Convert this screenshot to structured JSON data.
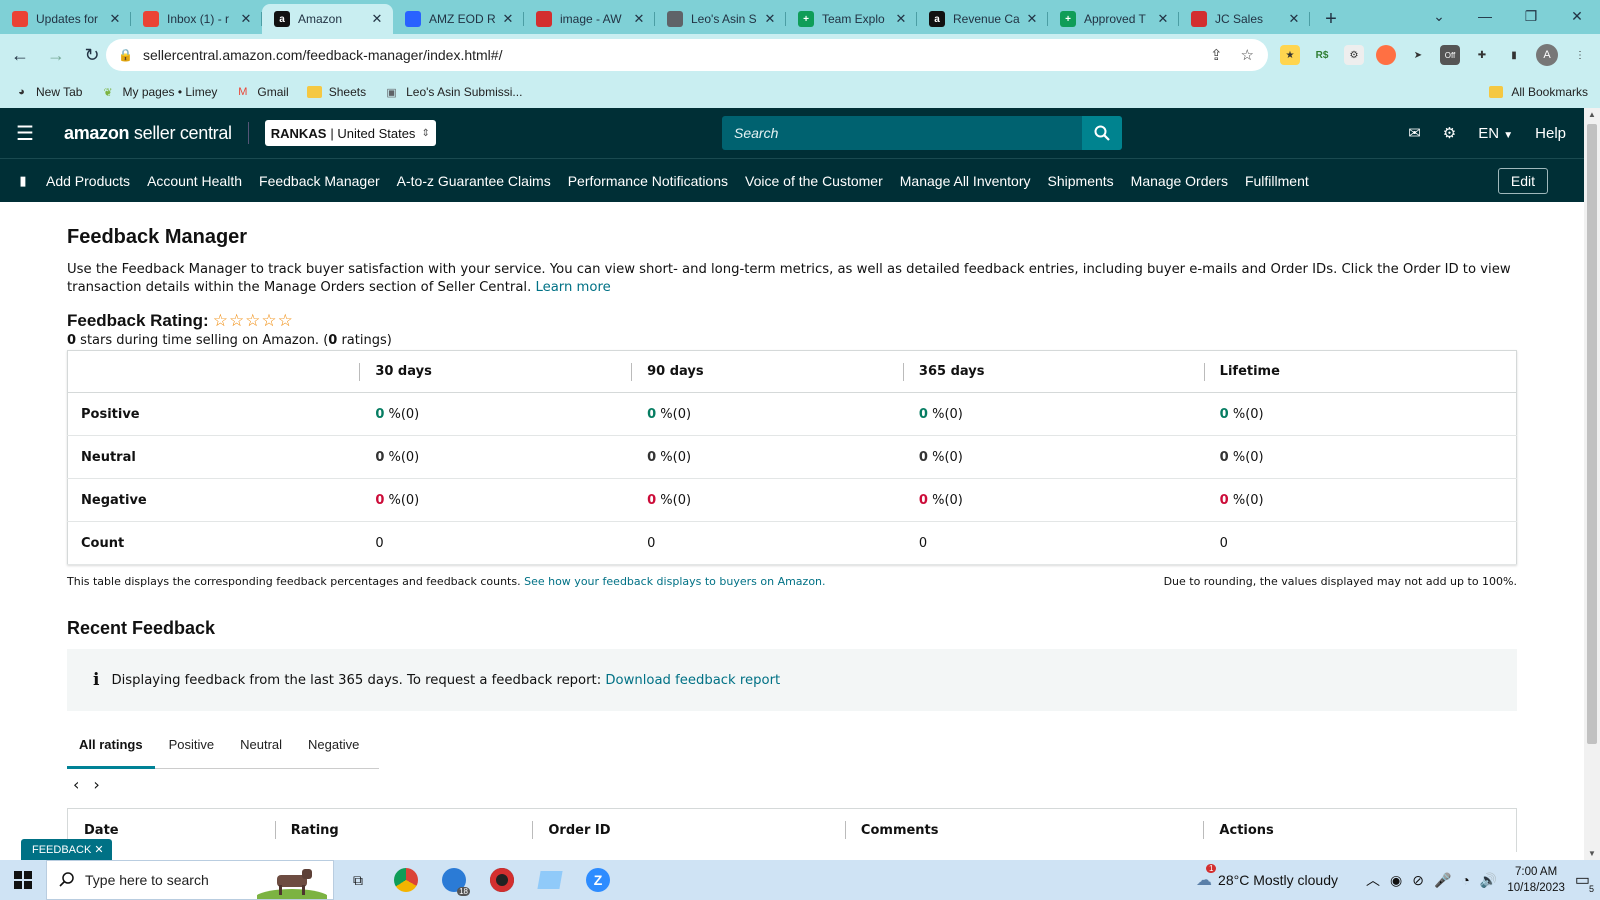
{
  "browser": {
    "tabs": [
      {
        "title": "Updates for",
        "icon": "gmail-icon",
        "color": "#ea4335"
      },
      {
        "title": "Inbox (1) - r",
        "icon": "gmail-icon",
        "color": "#ea4335"
      },
      {
        "title": "Amazon",
        "icon": "amazon-icon",
        "color": "#111111",
        "active": true
      },
      {
        "title": "AMZ EOD R",
        "icon": "pen-icon",
        "color": "#2962ff"
      },
      {
        "title": "image - AW",
        "icon": "vivaldi-icon",
        "color": "#d32f2f"
      },
      {
        "title": "Leo's Asin S",
        "icon": "form-icon",
        "color": "#5f6368"
      },
      {
        "title": "Team Explo",
        "icon": "sheets-icon",
        "color": "#0f9d58"
      },
      {
        "title": "Revenue Ca",
        "icon": "amazon-icon",
        "color": "#111111"
      },
      {
        "title": "Approved T",
        "icon": "sheets-icon",
        "color": "#0f9d58"
      },
      {
        "title": "JC Sales",
        "icon": "jc-icon",
        "color": "#d32f2f"
      }
    ],
    "url": "sellercentral.amazon.com/feedback-manager/index.html#/",
    "bookmarks": [
      {
        "label": "New Tab",
        "icon": "globe-icon"
      },
      {
        "label": "My pages • Limey",
        "icon": "leaf-icon"
      },
      {
        "label": "Gmail",
        "icon": "gmail-icon"
      },
      {
        "label": "Sheets",
        "icon": "folder-icon"
      },
      {
        "label": "Leo's Asin Submissi...",
        "icon": "form-icon"
      }
    ],
    "all_bookmarks": "All Bookmarks",
    "profile_initial": "A"
  },
  "header": {
    "logo_bold": "amazon",
    "logo_rest": " seller central",
    "store": "RANKAS",
    "marketplace": "| United States",
    "search_placeholder": "Search",
    "language": "EN",
    "help": "Help"
  },
  "nav": {
    "items": [
      "Add Products",
      "Account Health",
      "Feedback Manager",
      "A-to-z Guarantee Claims",
      "Performance Notifications",
      "Voice of the Customer",
      "Manage All Inventory",
      "Shipments",
      "Manage Orders",
      "Fulfillment"
    ],
    "edit": "Edit"
  },
  "page": {
    "title": "Feedback Manager",
    "intro": "Use the Feedback Manager to track buyer satisfaction with your service. You can view short- and long-term metrics, as well as detailed feedback entries, including buyer e-mails and Order IDs. Click the Order ID to view transaction details within the Manage Orders section of Seller Central.",
    "learn_more": "Learn more",
    "rating_label": "Feedback Rating:",
    "stars": "☆☆☆☆☆",
    "rating_count": "0",
    "rating_text": " stars during time selling on Amazon. (",
    "rating_num": "0",
    "rating_tail": " ratings)"
  },
  "metrics": {
    "columns": [
      "30 days",
      "90 days",
      "365 days",
      "Lifetime"
    ],
    "rows": [
      {
        "label": "Positive",
        "cells": [
          {
            "n": "0",
            "t": " %(0)"
          },
          {
            "n": "0",
            "t": " %(0)"
          },
          {
            "n": "0",
            "t": " %(0)"
          },
          {
            "n": "0",
            "t": " %(0)"
          }
        ]
      },
      {
        "label": "Neutral",
        "cells": [
          {
            "n": "0",
            "t": " %(0)"
          },
          {
            "n": "0",
            "t": " %(0)"
          },
          {
            "n": "0",
            "t": " %(0)"
          },
          {
            "n": "0",
            "t": " %(0)"
          }
        ]
      },
      {
        "label": "Negative",
        "cells": [
          {
            "n": "0",
            "t": " %(0)"
          },
          {
            "n": "0",
            "t": " %(0)"
          },
          {
            "n": "0",
            "t": " %(0)"
          },
          {
            "n": "0",
            "t": " %(0)"
          }
        ]
      },
      {
        "label": "Count",
        "cells": [
          {
            "n": "",
            "t": "0"
          },
          {
            "n": "",
            "t": "0"
          },
          {
            "n": "",
            "t": "0"
          },
          {
            "n": "",
            "t": "0"
          }
        ]
      }
    ],
    "note": "This table displays the corresponding feedback percentages and feedback counts.",
    "note_link": "See how your feedback displays to buyers on Amazon.",
    "rounding": "Due to rounding, the values displayed may not add up to 100%."
  },
  "recent": {
    "title": "Recent Feedback",
    "info_icon": "i",
    "info": "Displaying feedback from the last 365 days. To request a feedback report:",
    "info_link": "Download feedback report",
    "tabs": [
      "All ratings",
      "Positive",
      "Neutral",
      "Negative"
    ],
    "columns": [
      "Date",
      "Rating",
      "Order ID",
      "Comments",
      "Actions"
    ]
  },
  "feedback_pill": "FEEDBACK",
  "taskbar": {
    "search_placeholder": "Type here to search",
    "weather_badge": "1",
    "weather": "28°C  Mostly cloudy",
    "time": "7:00 AM",
    "date": "10/18/2023",
    "notif_count": "5",
    "edge_badge": "18"
  }
}
